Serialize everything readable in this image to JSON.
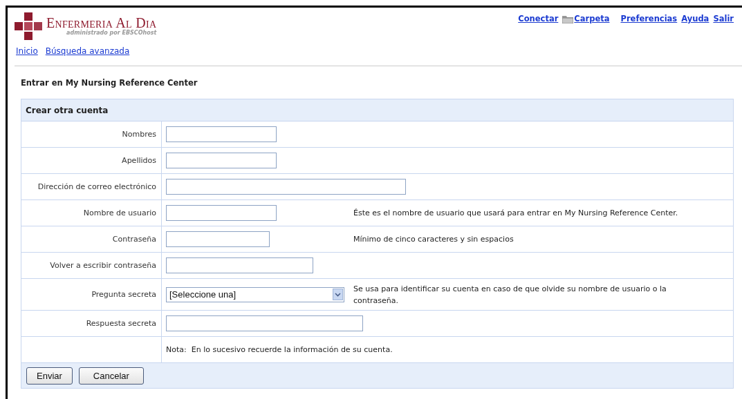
{
  "header": {
    "logo": {
      "title": "Enfermeria Al Dia",
      "subtitle": "administrado por EBSCOhost"
    },
    "top_links": [
      {
        "label": "Conectar",
        "kind": "link"
      },
      {
        "label": "Carpeta",
        "kind": "folder"
      },
      {
        "label": "Preferencias",
        "kind": "link"
      },
      {
        "label": "Ayuda",
        "kind": "link"
      },
      {
        "label": "Salir",
        "kind": "link"
      }
    ],
    "nav": [
      "Inicio",
      "Búsqueda avanzada"
    ]
  },
  "page_title": "Entrar en My Nursing Reference Center",
  "form": {
    "title": "Crear otra cuenta",
    "fields": [
      {
        "label": "Nombres",
        "kind": "text"
      },
      {
        "label": "Apellidos",
        "kind": "text"
      },
      {
        "label": "Dirección de correo electrónico",
        "kind": "text"
      },
      {
        "label": "Nombre de usuario",
        "kind": "text",
        "hint": "Éste es el nombre de usuario que usará para entrar en My Nursing Reference Center."
      },
      {
        "label": "Contraseña",
        "kind": "password",
        "hint": "Mínimo de cinco caracteres y sin espacios"
      },
      {
        "label": "Volver a escribir contraseña",
        "kind": "password"
      },
      {
        "label": "Pregunta secreta",
        "kind": "select",
        "value": "[Seleccione una]",
        "hint": "Se usa para identificar su cuenta en caso de que olvide su nombre de usuario o la contraseña."
      },
      {
        "label": "Respuesta secreta",
        "kind": "text"
      }
    ],
    "note": "Nota:  En lo sucesivo recuerde la información de su cuenta.",
    "buttons": [
      "Enviar",
      "Cancelar"
    ]
  }
}
